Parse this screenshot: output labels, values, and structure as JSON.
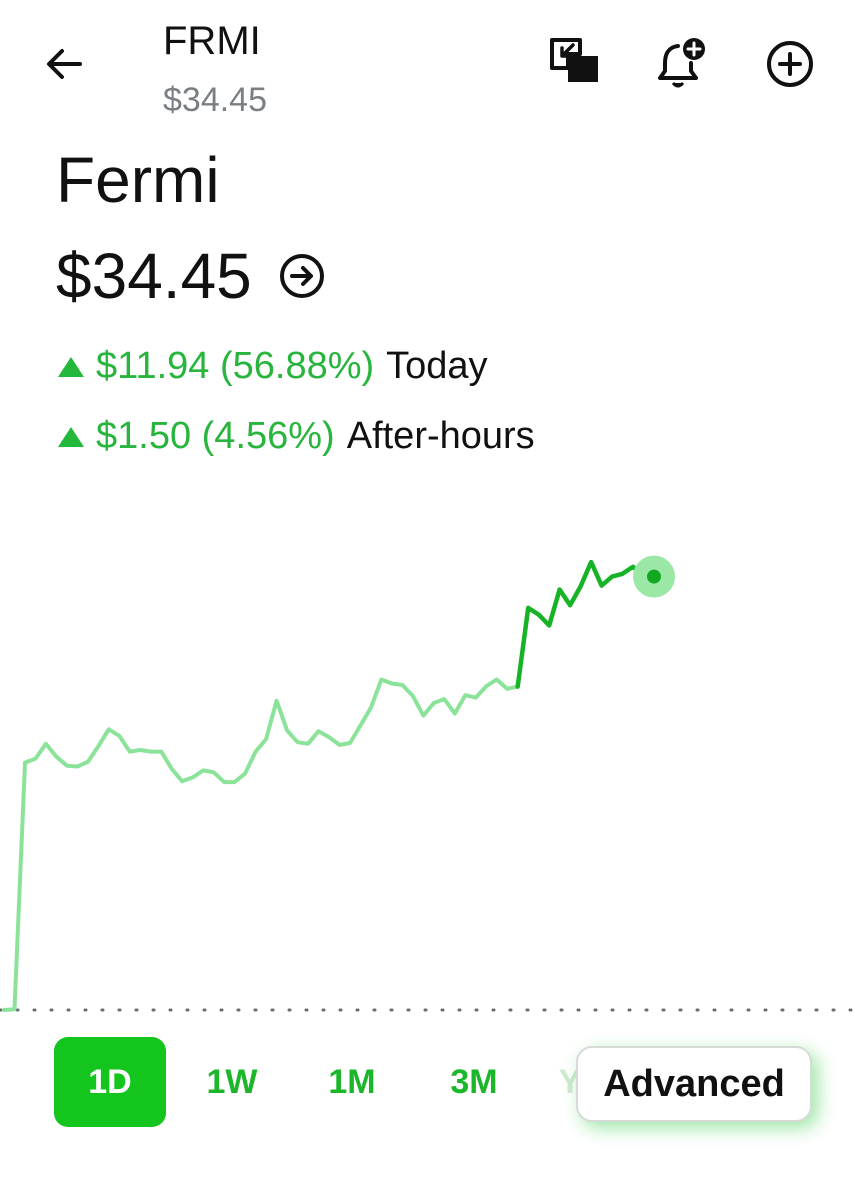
{
  "header": {
    "ticker": "FRMI",
    "price": "$34.45"
  },
  "quote": {
    "company_name": "Fermi",
    "price": "$34.45",
    "today_change": "$11.94 (56.88%)",
    "today_label": "Today",
    "after_hours_change": "$1.50 (4.56%)",
    "after_hours_label": "After-hours"
  },
  "icons": {
    "back": "arrow-left-icon",
    "pip": "picture-in-picture-icon",
    "alert": "bell-plus-icon",
    "add": "plus-circle-icon",
    "details": "arrow-right-circle-icon"
  },
  "colors": {
    "up_green": "#27b53d",
    "active_tab": "#14c51e",
    "line_regular": "#8be39a",
    "line_extended": "#17b326"
  },
  "range_tabs": [
    {
      "label": "1D",
      "active": true
    },
    {
      "label": "1W",
      "active": false
    },
    {
      "label": "1M",
      "active": false
    },
    {
      "label": "3M",
      "active": false
    },
    {
      "label": "Y",
      "active": false
    }
  ],
  "advanced_label": "Advanced",
  "chart_data": {
    "type": "line",
    "series": [
      {
        "values": [
          23.38,
          23.4,
          29.7,
          29.8,
          30.18,
          29.85,
          29.62,
          29.6,
          29.72,
          30.12,
          30.55,
          30.38,
          29.98,
          30.02,
          29.98,
          29.98,
          29.54,
          29.22,
          29.32,
          29.5,
          29.45,
          29.2,
          29.2,
          29.42,
          29.98,
          30.3,
          31.28,
          30.52,
          30.22,
          30.18,
          30.5,
          30.35,
          30.15,
          30.2,
          30.65,
          31.1,
          31.82,
          31.72,
          31.68,
          31.4,
          30.9,
          31.22,
          31.32,
          30.95,
          31.42,
          31.36,
          31.65,
          31.82,
          31.58,
          31.64
        ]
      },
      {
        "values": [
          31.64,
          33.65,
          33.48,
          33.2,
          34.12,
          33.72,
          34.2,
          34.82,
          34.22,
          34.45,
          34.52,
          34.7,
          34.45,
          34.45
        ]
      }
    ],
    "baseline": 23.38,
    "ylim": [
      23.38,
      34.95
    ],
    "grid": false
  }
}
